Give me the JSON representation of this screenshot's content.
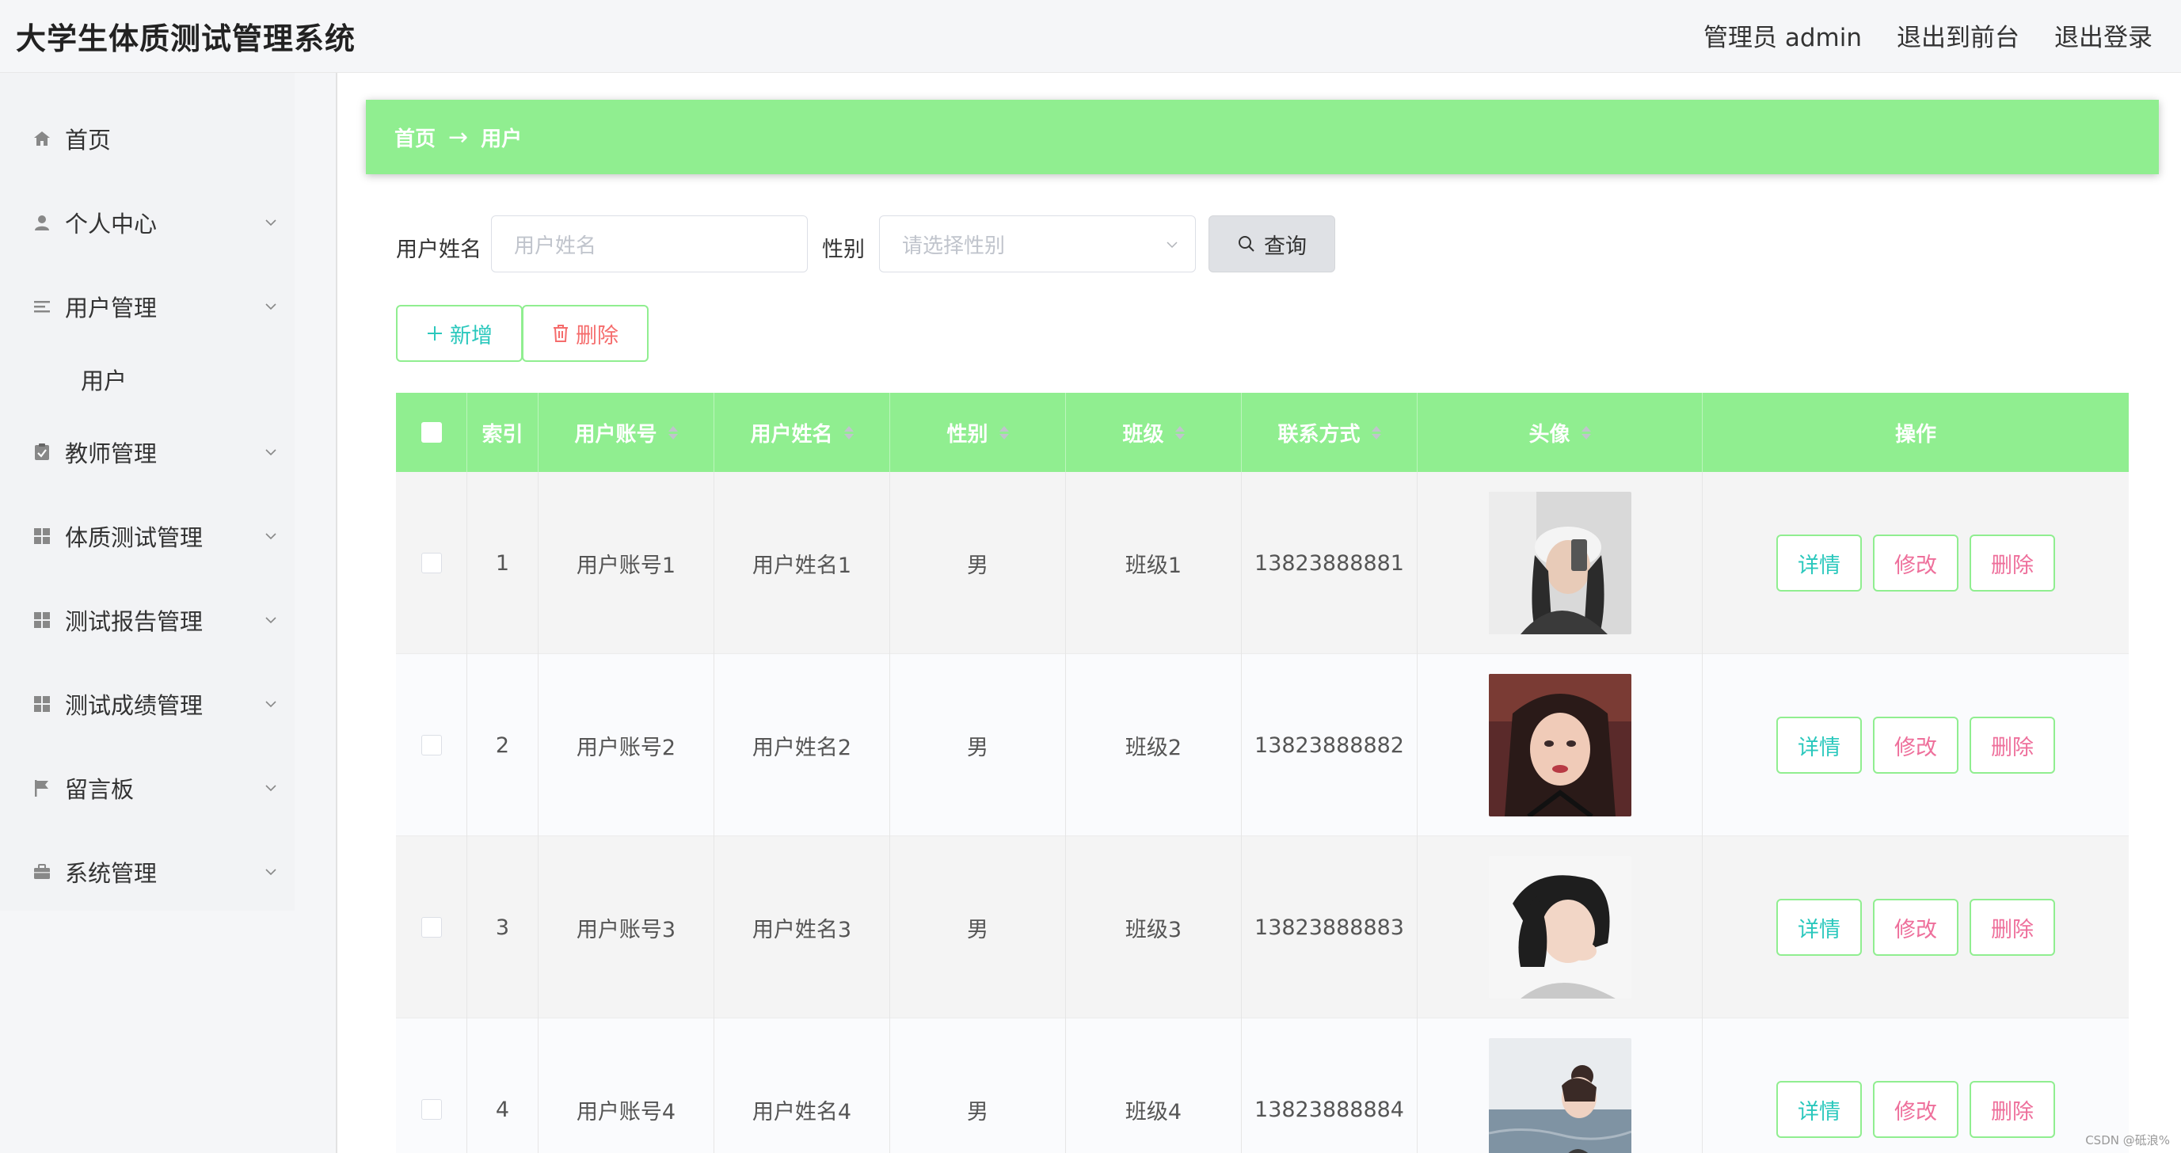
{
  "app": {
    "title": "大学生体质测试管理系统"
  },
  "header": {
    "admin_label": "管理员 admin",
    "to_front": "退出到前台",
    "logout": "退出登录"
  },
  "sidebar": {
    "items": [
      {
        "label": "首页",
        "icon": "home-icon"
      },
      {
        "label": "个人中心",
        "icon": "user-icon"
      },
      {
        "label": "用户管理",
        "icon": "list-icon"
      },
      {
        "label": "用户",
        "icon": ""
      },
      {
        "label": "教师管理",
        "icon": "clipboard-check-icon"
      },
      {
        "label": "体质测试管理",
        "icon": "grid-icon"
      },
      {
        "label": "测试报告管理",
        "icon": "grid-icon"
      },
      {
        "label": "测试成绩管理",
        "icon": "grid-icon"
      },
      {
        "label": "留言板",
        "icon": "flag-icon"
      },
      {
        "label": "系统管理",
        "icon": "briefcase-icon"
      }
    ]
  },
  "breadcrumb": {
    "home": "首页",
    "current": "用户"
  },
  "search": {
    "name_label": "用户姓名",
    "name_placeholder": "用户姓名",
    "gender_label": "性别",
    "gender_placeholder": "请选择性别",
    "query_label": "查询"
  },
  "actions": {
    "add_label": "新增",
    "delete_label": "删除"
  },
  "table": {
    "headers": [
      "索引",
      "用户账号",
      "用户姓名",
      "性别",
      "班级",
      "联系方式",
      "头像",
      "操作"
    ],
    "rows": [
      {
        "index": "1",
        "account": "用户账号1",
        "name": "用户姓名1",
        "gender": "男",
        "class": "班级1",
        "phone": "13823888881"
      },
      {
        "index": "2",
        "account": "用户账号2",
        "name": "用户姓名2",
        "gender": "男",
        "class": "班级2",
        "phone": "13823888882"
      },
      {
        "index": "3",
        "account": "用户账号3",
        "name": "用户姓名3",
        "gender": "男",
        "class": "班级3",
        "phone": "13823888883"
      },
      {
        "index": "4",
        "account": "用户账号4",
        "name": "用户姓名4",
        "gender": "男",
        "class": "班级4",
        "phone": "13823888884"
      }
    ],
    "op_detail": "详情",
    "op_edit": "修改",
    "op_delete": "删除"
  },
  "colors": {
    "accent": "#90ee90",
    "teal_text": "#2bc8bd",
    "pink_text": "#ee6f9b",
    "red_text": "#f56c6c"
  },
  "watermark": "CSDN @砥浪%"
}
